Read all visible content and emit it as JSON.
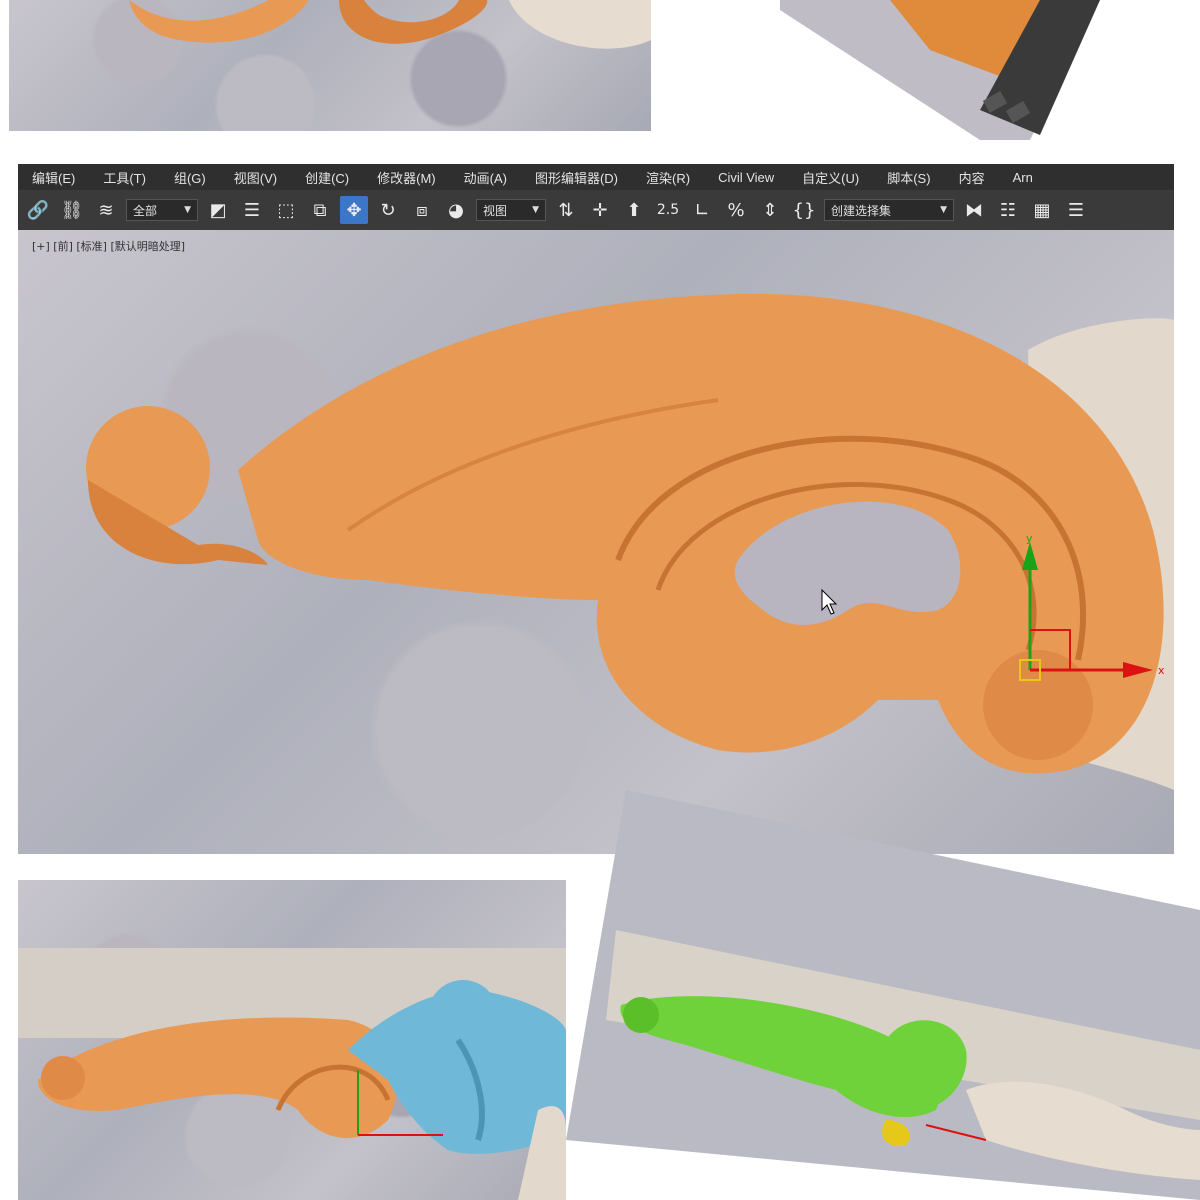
{
  "menu": {
    "items": [
      "编辑(E)",
      "工具(T)",
      "组(G)",
      "视图(V)",
      "创建(C)",
      "修改器(M)",
      "动画(A)",
      "图形编辑器(D)",
      "渲染(R)",
      "Civil View",
      "自定义(U)",
      "脚本(S)",
      "内容",
      "Arn"
    ]
  },
  "toolbar": {
    "filter_select": "全部",
    "refcoord_select": "视图",
    "selection_set_select": "创建选择集",
    "icons": [
      "link-icon",
      "unlink-icon",
      "bind-spacewarp-icon",
      "select-object-icon",
      "select-by-name-icon",
      "rect-selection-icon",
      "window-crossing-icon",
      "move-icon",
      "rotate-icon",
      "scale-icon",
      "placement-icon",
      "pivot-icon",
      "snap-2_5-icon",
      "angle-snap-icon",
      "percent-snap-icon",
      "spinner-snap-icon",
      "edit-named-sets-icon",
      "mirror-icon",
      "align-icon",
      "layer-explorer-icon",
      "scene-explorer-icon"
    ],
    "snap_label": "2.5"
  },
  "viewport": {
    "label": "[+] [前] [标准] [默认明暗处理]"
  },
  "gizmo": {
    "y_label": "y",
    "x_label": "x"
  },
  "colors": {
    "orange": "#e89a55",
    "blue": "#6fb8d8",
    "green": "#6fd23a",
    "cream": "#e2d8cb",
    "toolbar_bg": "#3a3a3a",
    "menubar_bg": "#2f2f2f",
    "active_tool": "#3b76c8"
  }
}
